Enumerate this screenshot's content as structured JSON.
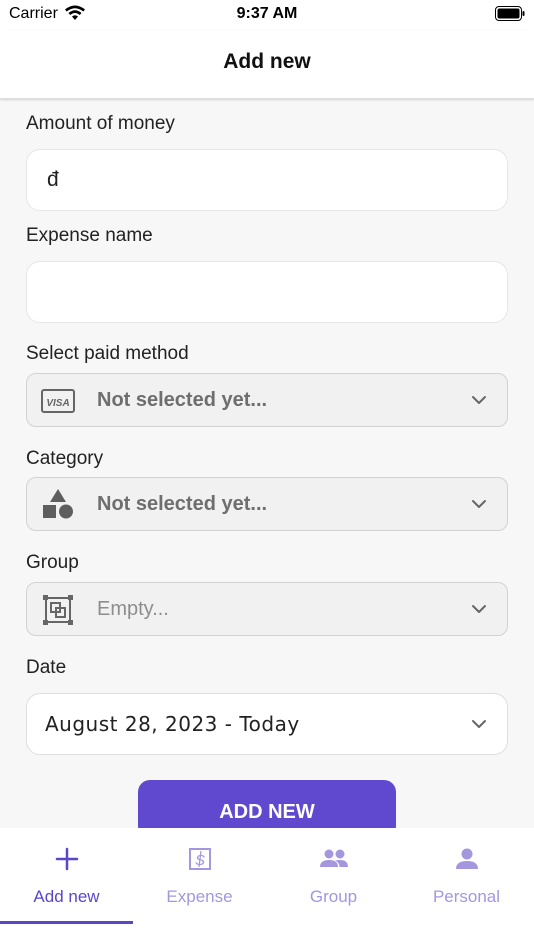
{
  "status_bar": {
    "carrier": "Carrier",
    "time": "9:37 AM"
  },
  "header": {
    "title": "Add new"
  },
  "form": {
    "amount": {
      "label": "Amount of money",
      "value": "đ"
    },
    "expense_name": {
      "label": "Expense name",
      "value": ""
    },
    "paid_method": {
      "label": "Select paid method",
      "value": "Not selected yet...",
      "icon": "visa-card-icon"
    },
    "category": {
      "label": "Category",
      "value": "Not selected yet...",
      "icon": "shapes-icon"
    },
    "group": {
      "label": "Group",
      "value": "Empty...",
      "icon": "group-frame-icon"
    },
    "date": {
      "label": "Date",
      "value": "August 28, 2023 - Today"
    },
    "submit_label": "ADD NEW"
  },
  "tab_bar": {
    "tabs": [
      {
        "label": "Add new",
        "icon": "plus-icon",
        "active": true
      },
      {
        "label": "Expense",
        "icon": "dollar-box-icon",
        "active": false
      },
      {
        "label": "Group",
        "icon": "people-icon",
        "active": false
      },
      {
        "label": "Personal",
        "icon": "person-icon",
        "active": false
      }
    ]
  },
  "colors": {
    "accent": "#6049cf",
    "inactive_tab": "#a497de",
    "background": "#f7f7f7"
  }
}
